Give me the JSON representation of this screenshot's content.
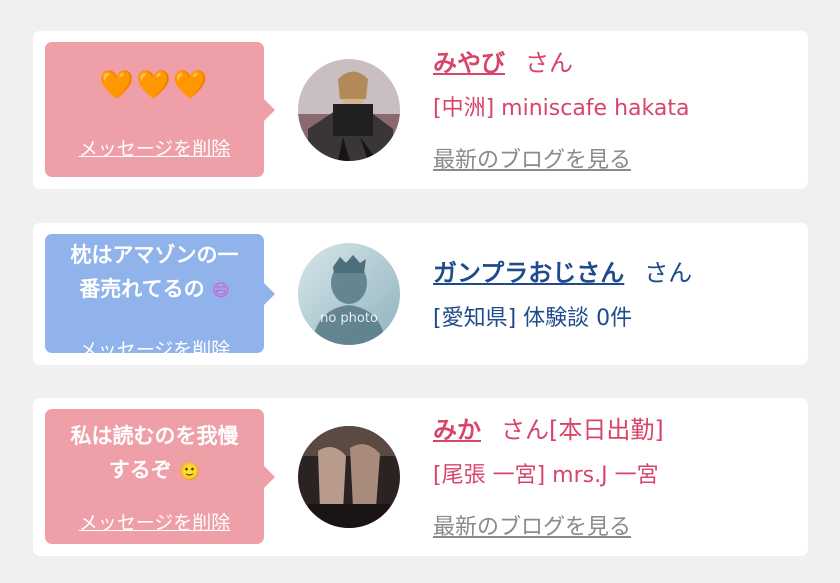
{
  "cards": [
    {
      "bubble": {
        "hearts": "🧡🧡🧡",
        "delete_label": "メッセージを削除"
      },
      "name": "みやび",
      "suffix": "さん",
      "shop": "[中洲] miniscafe hakata",
      "blog_link": "最新のブログを見る"
    },
    {
      "bubble": {
        "line1": "枕はアマゾンの一",
        "line2": "番売れてるの",
        "emoji": "😄",
        "delete_label": "メッセージを削除"
      },
      "name": "ガンプラおじさん",
      "suffix": "さん",
      "shop": "[愛知県] 体験談 0件",
      "avatar_text": "no photo"
    },
    {
      "bubble": {
        "line1": "私は読むのを我慢",
        "line2": "するぞ",
        "emoji": "🙂",
        "delete_label": "メッセージを削除"
      },
      "name": "みか",
      "suffix": "さん[本日出勤]",
      "shop": "[尾張 一宮] mrs.J 一宮",
      "blog_link": "最新のブログを見る"
    }
  ],
  "colors": {
    "page_bg": "#f0f0f0",
    "pink_bubble": "#ef9fa8",
    "blue_bubble": "#8fb3ea",
    "name_red": "#d8456a",
    "name_navy": "#1f4b8c",
    "link_gray": "#8a8a8a"
  }
}
